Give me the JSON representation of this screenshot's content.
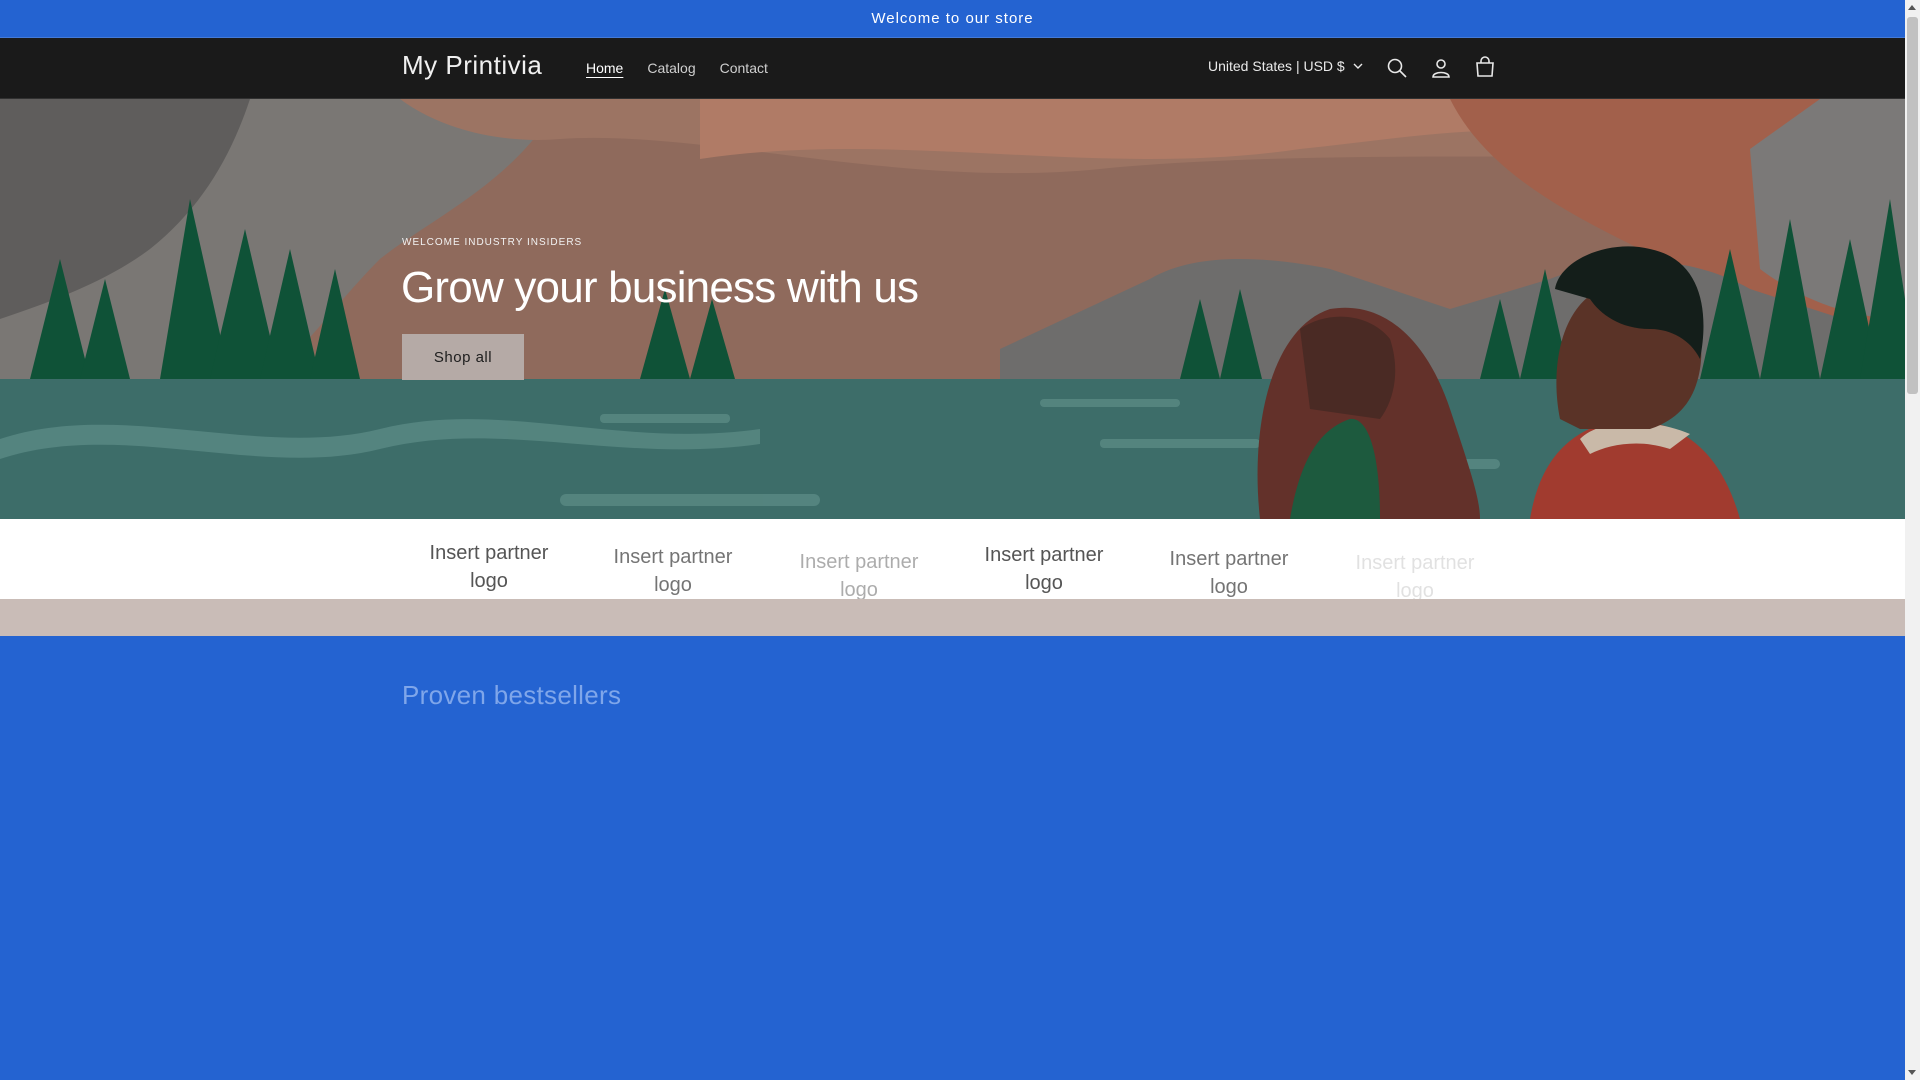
{
  "announcement": "Welcome to our store",
  "header": {
    "logo": "My Printivia",
    "nav": [
      "Home",
      "Catalog",
      "Contact"
    ],
    "country_selector": "United States | USD $",
    "icons": [
      "search-icon",
      "account-icon",
      "cart-icon"
    ]
  },
  "hero": {
    "subheading": "WELCOME INDUSTRY INSIDERS",
    "title": "Grow your business with us",
    "button": "Shop all"
  },
  "partners": {
    "items": [
      "Insert partner logo",
      "Insert partner logo",
      "Insert partner logo",
      "Insert partner logo",
      "Insert partner logo",
      "Insert partner logo"
    ]
  },
  "bestsellers": {
    "title": "Proven bestsellers"
  },
  "colors": {
    "brand_blue": "#2463d1",
    "header_bg": "#1a1a1a",
    "button_bg": "#b5aaa6",
    "band": "#c9bcb7"
  }
}
